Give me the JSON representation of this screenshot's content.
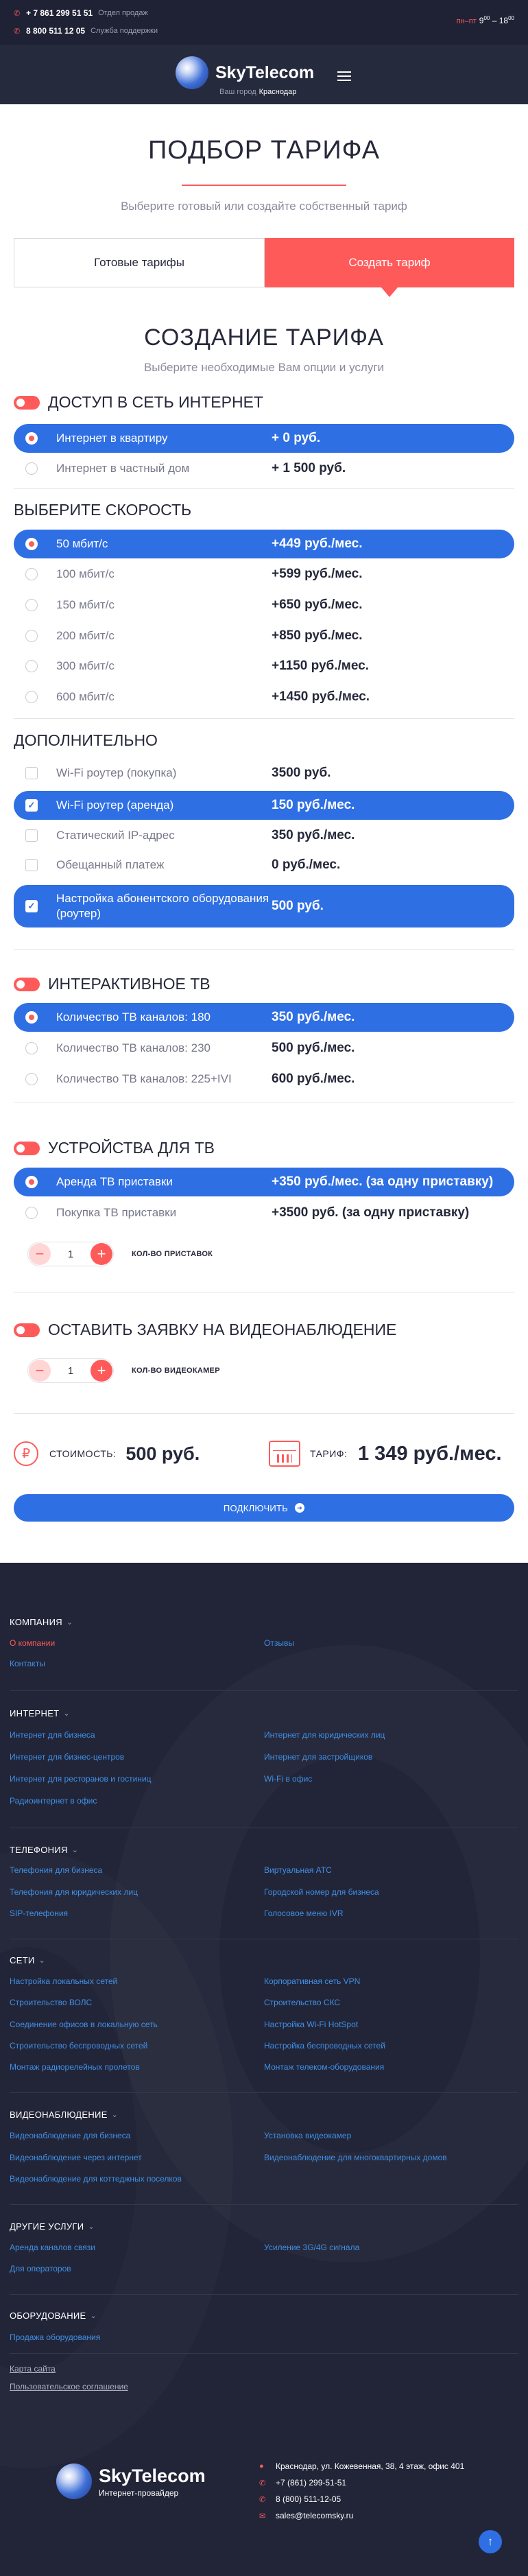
{
  "topbar": {
    "phone_sales": "+ 7 861 299 51 51",
    "phone_sales_label": "Отдел продаж",
    "phone_support": "8 800 511 12 05",
    "phone_support_label": "Служба поддержки",
    "hours_days": "пн–пт",
    "hours_from": "9",
    "hours_from_min": "00",
    "hours_dash": " – ",
    "hours_to": "18",
    "hours_to_min": "00"
  },
  "header": {
    "brand": "SkyTelecom",
    "city_label": "Ваш город",
    "city": "Краснодар"
  },
  "page": {
    "title": "ПОДБОР ТАРИФА",
    "subtitle": "Выберите готовый или создайте собственный тариф",
    "tabs": [
      "Готовые тарифы",
      "Создать тариф"
    ],
    "constructor_title": "СОЗДАНИЕ ТАРИФА",
    "constructor_subtitle": "Выберите необходимые Вам опции и услуги"
  },
  "sections": {
    "internet": {
      "title": "ДОСТУП В СЕТЬ ИНТЕРНЕТ",
      "options": [
        {
          "label": "Интернет в квартиру",
          "price": "+ 0 руб."
        },
        {
          "label": "Интернет в частный дом",
          "price": "+ 1 500 руб."
        }
      ]
    },
    "speed": {
      "title": "ВЫБЕРИТЕ СКОРОСТЬ",
      "options": [
        {
          "label": "50 мбит/с",
          "price": "+449 руб./мес."
        },
        {
          "label": "100 мбит/с",
          "price": "+599 руб./мес."
        },
        {
          "label": "150 мбит/с",
          "price": "+650 руб./мес."
        },
        {
          "label": "200 мбит/с",
          "price": "+850 руб./мес."
        },
        {
          "label": "300 мбит/с",
          "price": "+1150 руб./мес."
        },
        {
          "label": "600 мбит/с",
          "price": "+1450 руб./мес."
        }
      ]
    },
    "extra": {
      "title": "ДОПОЛНИТЕЛЬНО",
      "options": [
        {
          "label": "Wi-Fi роутер (покупка)",
          "price": "3500 руб."
        },
        {
          "label": "Wi-Fi роутер (аренда)",
          "price": "150 руб./мес."
        },
        {
          "label": "Статический IP-адрес",
          "price": "350 руб./мес."
        },
        {
          "label": "Обещанный платеж",
          "price": "0 руб./мес."
        },
        {
          "label": "Настройка абонентского оборудования (роутер)",
          "price": "500 руб."
        }
      ]
    },
    "tv": {
      "title": "ИНТЕРАКТИВНОЕ ТВ",
      "options": [
        {
          "label": "Количество ТВ каналов: 180",
          "price": "350 руб./мес."
        },
        {
          "label": "Количество ТВ каналов: 230",
          "price": "500 руб./мес."
        },
        {
          "label": "Количество ТВ каналов: 225+IVI",
          "price": "600 руб./мес."
        }
      ]
    },
    "devices": {
      "title": "УСТРОЙСТВА ДЛЯ ТВ",
      "options": [
        {
          "label": "Аренда ТВ приставки",
          "price": "+350 руб./мес. (за одну приставку)"
        },
        {
          "label": "Покупка ТВ приставки",
          "price": "+3500 руб. (за одну приставку)"
        }
      ],
      "stepper_minus": "−",
      "stepper_plus": "+",
      "stepper_value": "1",
      "stepper_label": "КОЛ-ВО ПРИСТАВОК"
    },
    "video": {
      "title": "ОСТАВИТЬ ЗАЯВКУ НА ВИДЕОНАБЛЮДЕНИЕ",
      "stepper_value": "1",
      "stepper_label": "КОЛ-ВО ВИДЕОКАМЕР"
    }
  },
  "summary": {
    "rub_symbol": "₽",
    "cost_label": "СТОИМОСТЬ:",
    "cost_value": "500 руб.",
    "tariff_label": "ТАРИФ:",
    "tariff_value": "1 349 руб./мес.",
    "submit": "ПОДКЛЮЧИТЬ",
    "submit_icon": "➜"
  },
  "footer": {
    "company": {
      "title": "КОМПАНИЯ",
      "links": [
        "О компании",
        "Отзывы",
        "Контакты"
      ]
    },
    "internet": {
      "title": "ИНТЕРНЕТ",
      "links": [
        "Интернет для бизнеса",
        "Интернет для юридических лиц",
        "Интернет для бизнес-центров",
        "Интернет для застройщиков",
        "Интернет для ресторанов и гостиниц",
        "Wi-Fi в офис",
        "Радиоинтернет в офис"
      ]
    },
    "telephony": {
      "title": "ТЕЛЕФОНИЯ",
      "links": [
        "Телефония для бизнеса",
        "Виртуальная АТС",
        "Телефония для юридических лиц",
        "Городской номер для бизнеса",
        "SIP-телефония",
        "Голосовое меню IVR"
      ]
    },
    "networks": {
      "title": "СЕТИ",
      "links": [
        "Настройка локальных сетей",
        "Корпоративная сеть VPN",
        "Строительство ВОЛС",
        "Строительство СКС",
        "Соединение офисов в локальную сеть",
        "Настройка Wi-Fi HotSpot",
        "Строительство беспроводных сетей",
        "Настройка беспроводных сетей",
        "Монтаж радиорелейных пролетов",
        "Монтаж телеком-оборудования"
      ]
    },
    "video": {
      "title": "ВИДЕОНАБЛЮДЕНИЕ",
      "links": [
        "Видеонаблюдение для бизнеса",
        "Установка видеокамер",
        "Видеонаблюдение через интернет",
        "Видеонаблюдение для многоквартирных домов",
        "Видеонаблюдение для коттеджных поселков"
      ]
    },
    "other": {
      "title": "ДРУГИЕ УСЛУГИ",
      "links": [
        "Аренда каналов связи",
        "Усиление 3G/4G сигнала",
        "Для операторов"
      ]
    },
    "equipment": {
      "title": "ОБОРУДОВАНИЕ",
      "links": [
        "Продажа оборудования"
      ]
    },
    "sitemap": "Карта сайта",
    "agreement": "Пользовательское соглашение",
    "brand": "SkyTelecom",
    "tagline": "Интернет-провайдер",
    "address": "Краснодар, ул. Кожевенная, 38, 4 этаж, офис 401",
    "phone1": "+7 (861) 299-51-51",
    "phone2": "8 (800) 511-12-05",
    "email": "sales@telecomsky.ru",
    "up_icon": "↑"
  },
  "colors": {
    "accent": "#ff5a5a",
    "primary": "#2f6fe4",
    "dark": "#1f2235"
  }
}
